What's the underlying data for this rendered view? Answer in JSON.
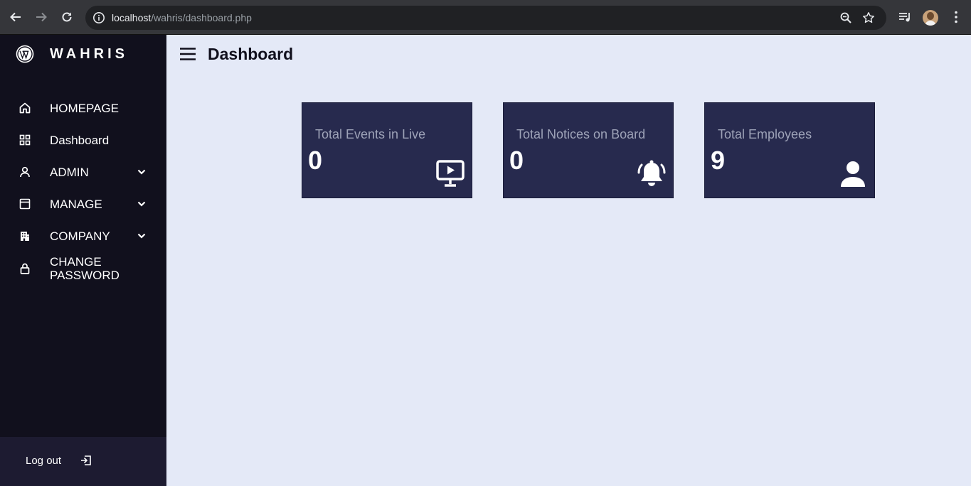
{
  "browser": {
    "url_host": "localhost",
    "url_path": "/wahris/dashboard.php"
  },
  "sidebar": {
    "brand": "WAHRIS",
    "items": [
      {
        "label": "HOMEPAGE",
        "icon": "home-icon"
      },
      {
        "label": "Dashboard",
        "icon": "grid-icon"
      },
      {
        "label": "ADMIN",
        "icon": "user-icon",
        "has_submenu": true
      },
      {
        "label": "MANAGE",
        "icon": "window-icon",
        "has_submenu": true
      },
      {
        "label": "COMPANY",
        "icon": "building-icon",
        "has_submenu": true
      },
      {
        "label": "CHANGE PASSWORD",
        "icon": "lock-icon"
      }
    ],
    "logout_label": "Log out"
  },
  "header": {
    "title": "Dashboard"
  },
  "cards": [
    {
      "title": "Total Events in Live",
      "value": "0",
      "icon": "monitor-play-icon"
    },
    {
      "title": "Total Notices on Board",
      "value": "0",
      "icon": "bell-ringing-icon"
    },
    {
      "title": "Total Employees",
      "value": "9",
      "icon": "user-solid-icon"
    }
  ],
  "colors": {
    "sidebar_bg": "#11101d",
    "main_bg": "#e4e9f7",
    "card_bg": "#272a4e",
    "logout_bg": "#1d1b31"
  }
}
